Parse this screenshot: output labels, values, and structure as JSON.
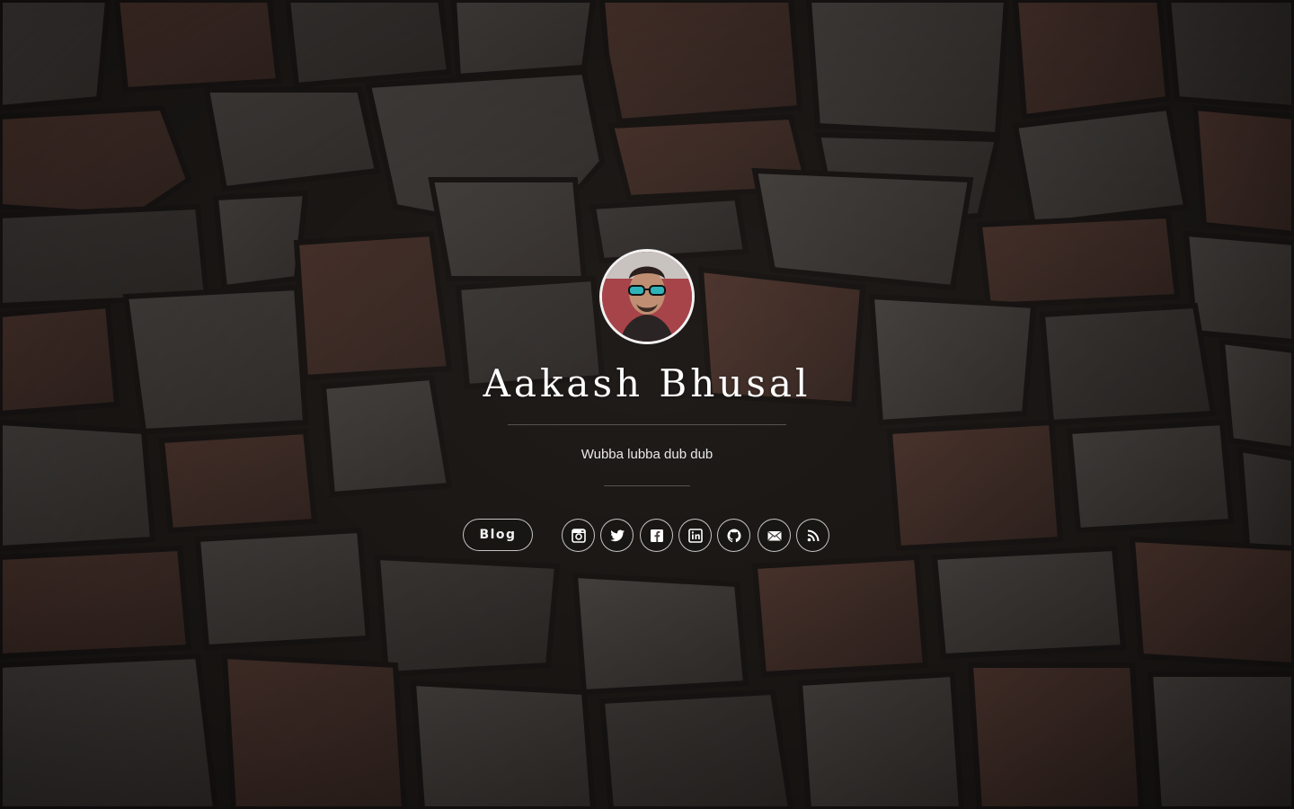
{
  "profile": {
    "name": "Aakash Bhusal",
    "tagline": "Wubba lubba dub dub"
  },
  "nav": {
    "blog_label": "Blog"
  },
  "social_links": [
    {
      "icon": "instagram-icon"
    },
    {
      "icon": "twitter-icon"
    },
    {
      "icon": "facebook-icon"
    },
    {
      "icon": "linkedin-icon"
    },
    {
      "icon": "github-icon"
    },
    {
      "icon": "email-icon"
    },
    {
      "icon": "rss-icon"
    }
  ],
  "colors": {
    "text": "#ffffff",
    "button_border": "#ffffff",
    "background_tone": "#3a302c",
    "stone_rust": "#8a4a32"
  }
}
